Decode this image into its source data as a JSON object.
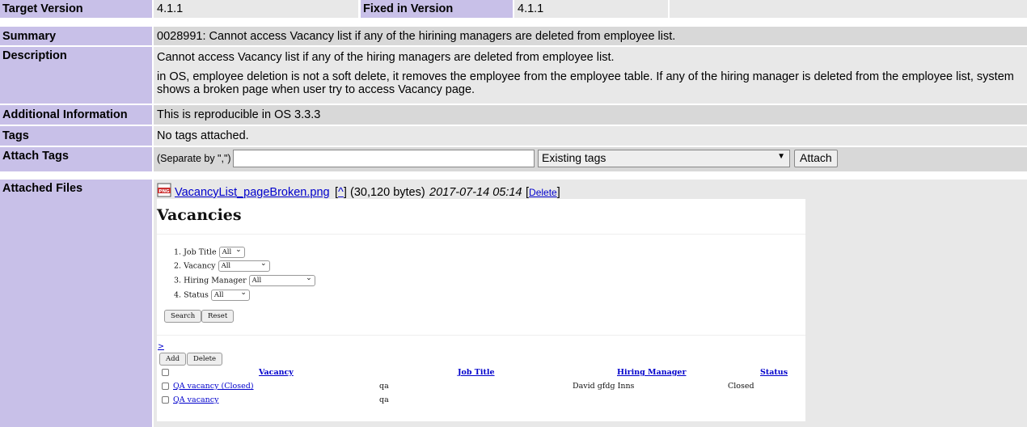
{
  "rows": {
    "target_version": {
      "label": "Target Version",
      "value": "4.1.1"
    },
    "fixed_in_version": {
      "label": "Fixed in Version",
      "value": "4.1.1"
    },
    "summary": {
      "label": "Summary",
      "value": "0028991: Cannot access Vacancy list if any of the hirining managers are deleted from employee list."
    },
    "description": {
      "label": "Description",
      "line1": "Cannot access Vacancy list if any of the hiring managers are deleted from employee list.",
      "line2": "in OS, employee deletion is not a soft delete, it removes the employee from the employee table. If any of the hiring manager is deleted from the employee list, system shows a broken page when user try to access Vacancy page."
    },
    "additional_info": {
      "label": "Additional Information",
      "value": "This is reproducible in OS 3.3.3"
    },
    "tags": {
      "label": "Tags",
      "value": "No tags attached."
    },
    "attach_tags": {
      "label": "Attach Tags",
      "separator_hint": "(Separate by \",\")",
      "input_value": "",
      "select_value": "Existing tags",
      "attach_button": "Attach"
    },
    "attached_files": {
      "label": "Attached Files",
      "file_icon": "png-file-icon",
      "filename": "VacancyList_pageBroken.png",
      "caret_link": "^",
      "size": "(30,120 bytes)",
      "date": "2017-07-14 05:14",
      "delete_link": "Delete"
    }
  },
  "screenshot": {
    "heading": "Vacancies",
    "filters": [
      {
        "label": "1. Job Title",
        "value": "All"
      },
      {
        "label": "2. Vacancy",
        "value": "All"
      },
      {
        "label": "3. Hiring Manager",
        "value": "All"
      },
      {
        "label": "4. Status",
        "value": "All"
      }
    ],
    "search_button": "Search",
    "reset_button": "Reset",
    "gt_link": ">",
    "add_button": "Add",
    "delete_button": "Delete",
    "columns": [
      "Vacancy",
      "Job Title",
      "Hiring Manager",
      "Status"
    ],
    "rows": [
      {
        "vacancy": "QA vacancy (Closed)",
        "job_title": "qa",
        "hiring_manager": "David gfdg Inns",
        "status": "Closed"
      },
      {
        "vacancy": "QA vacancy",
        "job_title": "qa",
        "hiring_manager": "",
        "status": ""
      }
    ]
  },
  "colors": {
    "label_bg": "#c8c0e8",
    "value_bg": "#e8e8e8",
    "alt_value_bg": "#d8d8d8",
    "link": "#0000cc"
  }
}
